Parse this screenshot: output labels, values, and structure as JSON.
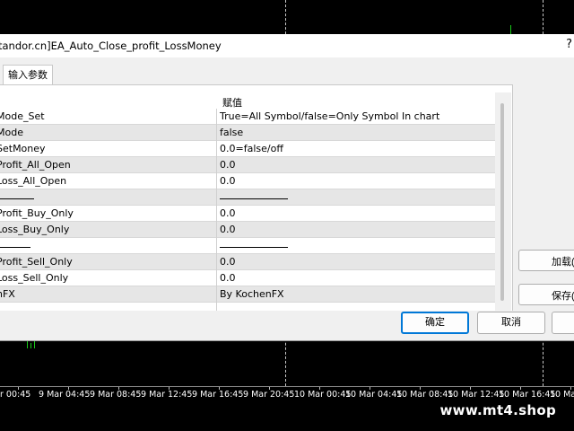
{
  "window": {
    "title": "tandor.cn]EA_Auto_Close_profit_LossMoney",
    "help_label": "?"
  },
  "tabs": [
    {
      "label": "输入参数"
    }
  ],
  "grid": {
    "header_value": "赋值",
    "rows": [
      {
        "name": "Mode_Set",
        "value": "True=All Symbol/false=Only Symbol In chart"
      },
      {
        "name": "Mode",
        "value": "false"
      },
      {
        "name": "SetMoney",
        "value": "0.0=false/off"
      },
      {
        "name": "Profit_All_Open",
        "value": "0.0"
      },
      {
        "name": "Loss_All_Open",
        "value": "0.0"
      },
      {
        "name": "",
        "value": ""
      },
      {
        "name": "Profit_Buy_Only",
        "value": "0.0"
      },
      {
        "name": "Loss_Buy_Only",
        "value": "0.0"
      },
      {
        "name": "",
        "value": ""
      },
      {
        "name": "Profit_Sell_Only",
        "value": "0.0"
      },
      {
        "name": "Loss_Sell_Only",
        "value": "0.0"
      },
      {
        "name": "nFX",
        "value": "By KochenFX"
      }
    ]
  },
  "side_buttons": {
    "load": "加载(",
    "save": "保存("
  },
  "buttons": {
    "ok": "确定",
    "cancel": "取消",
    "reset": ""
  },
  "time_axis": [
    "r 00:45",
    "9 Mar 04:45",
    "9 Mar 08:45",
    "9 Mar 12:45",
    "9 Mar 16:45",
    "9 Mar 20:45",
    "10 Mar 00:45",
    "10 Mar 04:45",
    "10 Mar 08:45",
    "10 Mar 12:45",
    "10 Mar 16:45",
    "10 Mar"
  ],
  "watermark": "www.mt4.shop"
}
